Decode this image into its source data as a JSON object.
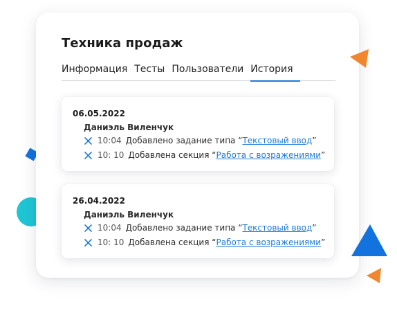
{
  "page": {
    "title": "Техника продаж"
  },
  "tabs": [
    {
      "label": "Информация",
      "active": false
    },
    {
      "label": "Тесты",
      "active": false
    },
    {
      "label": "Пользователи",
      "active": false
    },
    {
      "label": "История",
      "active": true
    }
  ],
  "history": [
    {
      "date": "06.05.2022",
      "user": "Даниэль Виленчук",
      "entries": [
        {
          "time": "10:04",
          "text": "Добавлено задание типа",
          "open_quote": "“",
          "link": "Текстовый ввод",
          "close_quote": "”"
        },
        {
          "time": "10: 10",
          "text": "Добавлена секция",
          "open_quote": "“",
          "link": "Работа с возражениями",
          "close_quote": "”"
        }
      ]
    },
    {
      "date": "26.04.2022",
      "user": "Даниэль Виленчук",
      "entries": [
        {
          "time": "10:04",
          "text": "Добавлено задание типа",
          "open_quote": "“",
          "link": "Текстовый ввод",
          "close_quote": "”"
        },
        {
          "time": "10: 10",
          "text": "Добавлена секция",
          "open_quote": "“",
          "link": "Работа с возражениями",
          "close_quote": "”"
        }
      ]
    }
  ],
  "icons": {
    "entry_icon": "close-x-icon"
  },
  "colors": {
    "accent": "#1e7ad8",
    "orange": "#f0872f",
    "teal": "#1ec6d4",
    "blue": "#1273de"
  }
}
